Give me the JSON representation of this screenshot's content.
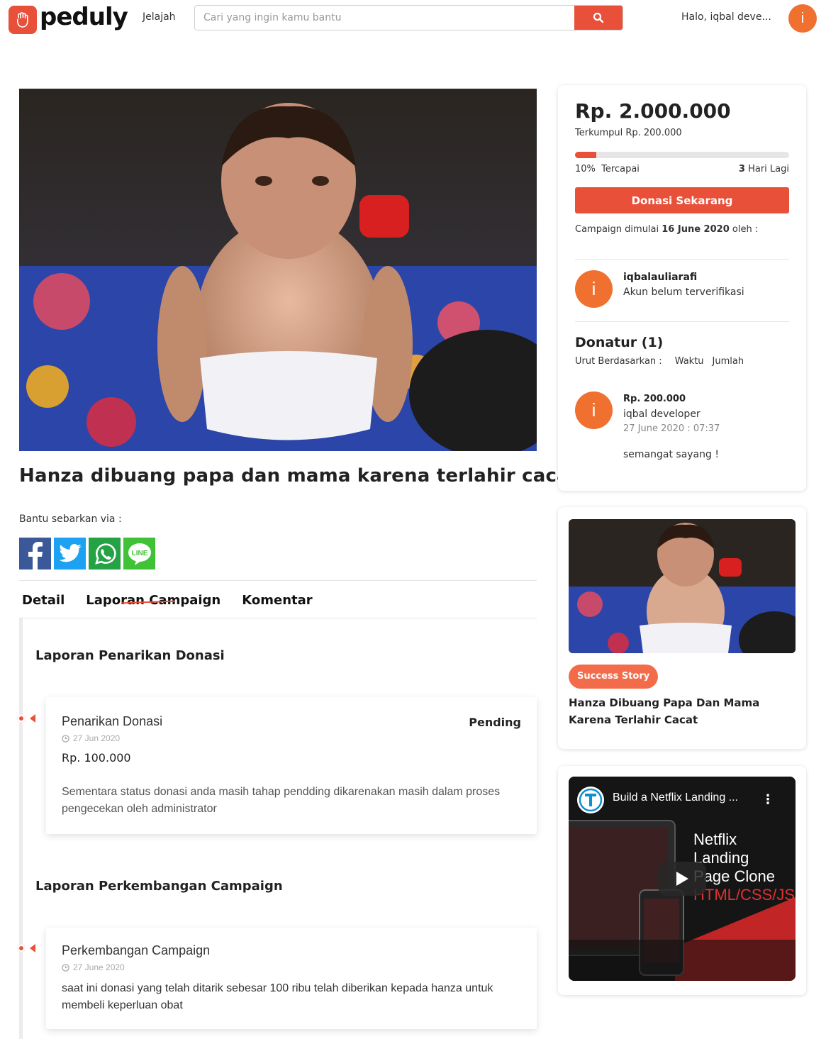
{
  "nav": {
    "brand": "peduly",
    "explore_label": "Jelajah",
    "search_placeholder": "Cari yang ingin kamu bantu",
    "greeting": "Halo, iqbal deve...",
    "avatar_initial": "i"
  },
  "campaign": {
    "title": "Hanza dibuang papa dan mama karena terlahir cacat",
    "share_label": "Bantu sebarkan via :",
    "share_channels": [
      "facebook-icon",
      "twitter-icon",
      "whatsapp-icon",
      "line-icon"
    ],
    "line_text": "LINE"
  },
  "tabs": [
    "Detail",
    "Laporan Campaign",
    "Komentar"
  ],
  "reports": {
    "withdrawal_heading": "Laporan Penarikan Donasi",
    "withdrawal": {
      "title": "Penarikan Donasi",
      "status": "Pending",
      "date": "27 Jun 2020",
      "amount": "Rp. 100.000",
      "body": "Sementara status donasi anda masih tahap pendding dikarenakan masih dalam proses pengecekan oleh administrator"
    },
    "progress_heading": "Laporan Perkembangan Campaign",
    "progress": {
      "title": "Perkembangan Campaign",
      "date": "27 June 2020",
      "body": "saat ini donasi yang telah ditarik sebesar 100 ribu telah diberikan kepada hanza untuk membeli keperluan obat"
    }
  },
  "summary": {
    "target": "Rp. 2.000.000",
    "collected": "Terkumpul Rp. 200.000",
    "progress_fraction": 0.1,
    "percent": "10%",
    "percent_label": "Tercapai",
    "days_left": "3",
    "days_label": "Hari Lagi",
    "donate_label": "Donasi Sekarang",
    "started_prefix": "Campaign dimulai ",
    "started_date": "16 June 2020",
    "started_suffix": " oleh :",
    "creator": {
      "initial": "i",
      "name": "iqbalauliarafi",
      "status": "Akun belum terverifikasi"
    },
    "donors_title": "Donatur (1)",
    "sort_label": "Urut Berdasarkan :",
    "sort_options": [
      "Waktu",
      "Jumlah"
    ],
    "donor": {
      "initial": "i",
      "amount": "Rp. 200.000",
      "name": "iqbal developer",
      "time": "27 June 2020 : 07:37",
      "message": "semangat sayang !"
    }
  },
  "story": {
    "badge": "Success Story",
    "title": "Hanza Dibuang Papa Dan Mama Karena Terlahir Cacat"
  },
  "video": {
    "title": "Build a Netflix Landing ...",
    "overlay_line1": "Netflix Landing",
    "overlay_line2": "Page Clone",
    "overlay_tag": "HTML/CSS/JS",
    "menu_glyph": "⋮"
  },
  "colors": {
    "accent": "#e8503a",
    "avatar": "#f07030",
    "badge": "#f26b4b"
  }
}
